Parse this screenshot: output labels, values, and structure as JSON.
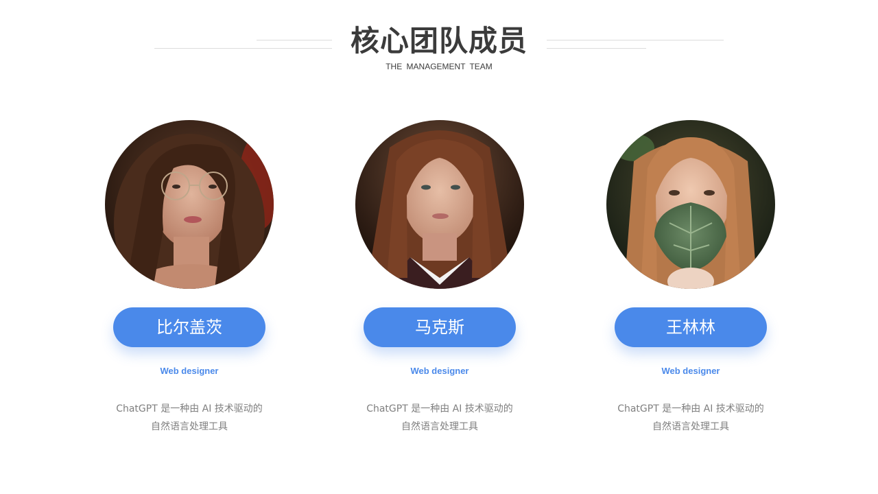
{
  "header": {
    "title": "核心团队成员",
    "subtitle": "THE  MANAGEMENT   TEAM"
  },
  "members": [
    {
      "name": "比尔盖茨",
      "role": "Web designer",
      "desc_line1": "ChatGPT 是一种由 AI 技术驱动的",
      "desc_line2": "自然语言处理工具",
      "photo": "woman-with-glasses-portrait"
    },
    {
      "name": "马克斯",
      "role": "Web designer",
      "desc_line1": "ChatGPT 是一种由 AI 技术驱动的",
      "desc_line2": "自然语言处理工具",
      "photo": "woman-with-freckles-portrait"
    },
    {
      "name": "王林林",
      "role": "Web designer",
      "desc_line1": "ChatGPT 是一种由 AI 技术驱动的",
      "desc_line2": "自然语言处理工具",
      "photo": "woman-holding-leaf-portrait"
    }
  ],
  "colors": {
    "accent": "#4a89ea",
    "title": "#3b3b3b",
    "body_text": "#7f7f7f",
    "divider": "#dcdcdc"
  }
}
